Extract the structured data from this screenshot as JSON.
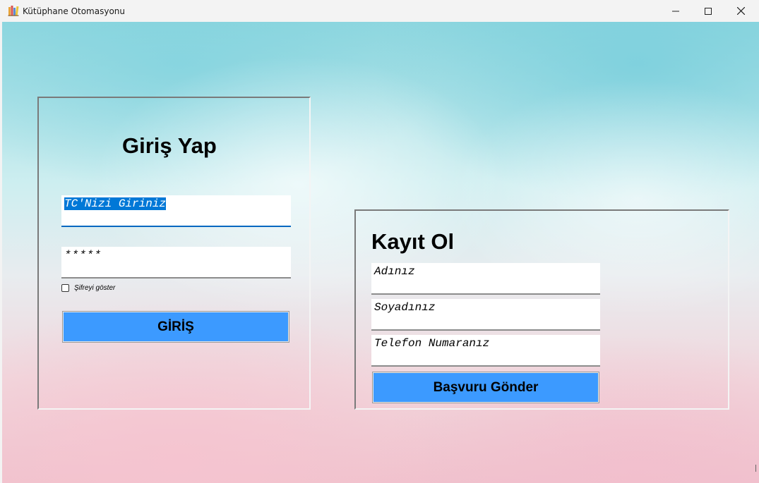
{
  "window": {
    "title": "Kütüphane Otomasyonu",
    "icons": [
      "books-icon",
      "minimize-icon",
      "maximize-icon",
      "close-icon"
    ]
  },
  "login": {
    "heading": "Giriş Yap",
    "tc_value": "TC'Nizi Giriniz",
    "password_value": "*****",
    "show_password_label": "Şifreyi göster",
    "show_password_checked": false,
    "button_label": "GİRİŞ"
  },
  "register": {
    "heading": "Kayıt Ol",
    "name_value": "Adınız",
    "surname_value": "Soyadınız",
    "phone_value": "Telefon Numaranız",
    "button_label": "Başvuru Gönder"
  },
  "colors": {
    "button": "#3c9aff",
    "selection": "#0078d7",
    "focus_underline": "#0067c0"
  }
}
